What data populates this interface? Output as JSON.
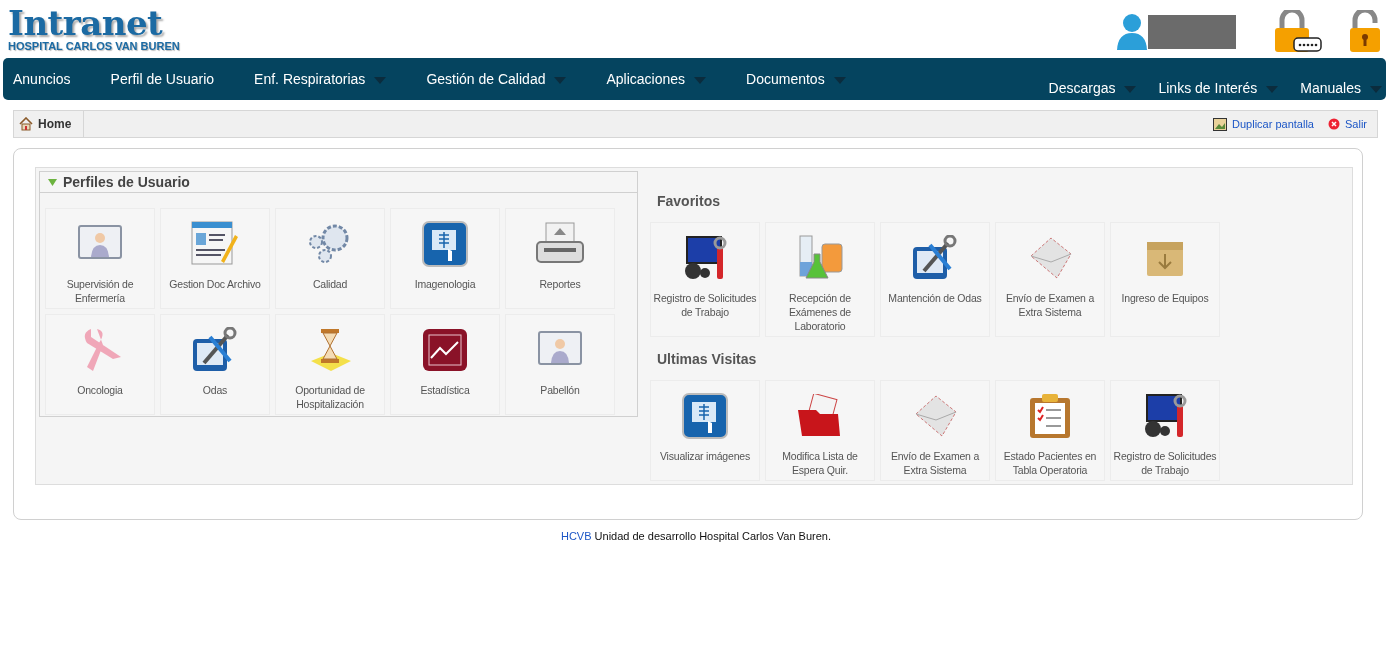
{
  "header": {
    "logo_title": "Intranet",
    "logo_subtitle": "HOSPITAL CARLOS VAN BUREN"
  },
  "nav": {
    "left": [
      {
        "label": "Anuncios",
        "dropdown": false
      },
      {
        "label": "Perfil de Usuario",
        "dropdown": false
      },
      {
        "label": "Enf. Respiratorias",
        "dropdown": true
      },
      {
        "label": "Gestión de Calidad",
        "dropdown": true
      },
      {
        "label": "Aplicaciones",
        "dropdown": true
      },
      {
        "label": "Documentos",
        "dropdown": true
      }
    ],
    "right": [
      {
        "label": "Descargas",
        "dropdown": true
      },
      {
        "label": "Links de Interés",
        "dropdown": true
      },
      {
        "label": "Manuales",
        "dropdown": true
      }
    ]
  },
  "breadcrumb": {
    "tab": "Home",
    "actions": [
      "Duplicar pantalla",
      "Salir"
    ]
  },
  "profiles": {
    "title": "Perfiles de Usuario",
    "expanded": true,
    "items": [
      {
        "label": "Supervisión de Enfermería"
      },
      {
        "label": "Gestion Doc Archivo"
      },
      {
        "label": "Calidad"
      },
      {
        "label": "Imagenologia"
      },
      {
        "label": "Reportes"
      },
      {
        "label": "Oncologia"
      },
      {
        "label": "Odas"
      },
      {
        "label": "Oportunidad de Hospitalización"
      },
      {
        "label": "Estadística"
      },
      {
        "label": "Pabellón"
      }
    ]
  },
  "favorites": {
    "title": "Favoritos",
    "items": [
      {
        "label": "Registro de Solicitudes de Trabajo"
      },
      {
        "label": "Recepción de Exámenes de Laboratorio"
      },
      {
        "label": "Mantención de Odas"
      },
      {
        "label": "Envío de Examen a Extra Sistema"
      },
      {
        "label": "Ingreso de Equipos"
      }
    ]
  },
  "recent": {
    "title": "Ultimas Visitas",
    "items": [
      {
        "label": "Visualizar imágenes"
      },
      {
        "label": "Modifica Lista de Espera Quir."
      },
      {
        "label": "Envío de Examen a Extra Sistema"
      },
      {
        "label": "Estado Pacientes en Tabla Operatoria"
      },
      {
        "label": "Registro de Solicitudes de Trabajo"
      }
    ]
  },
  "footer": {
    "link": "HCVB",
    "text": "Unidad de desarrollo Hospital Carlos Van Buren."
  }
}
